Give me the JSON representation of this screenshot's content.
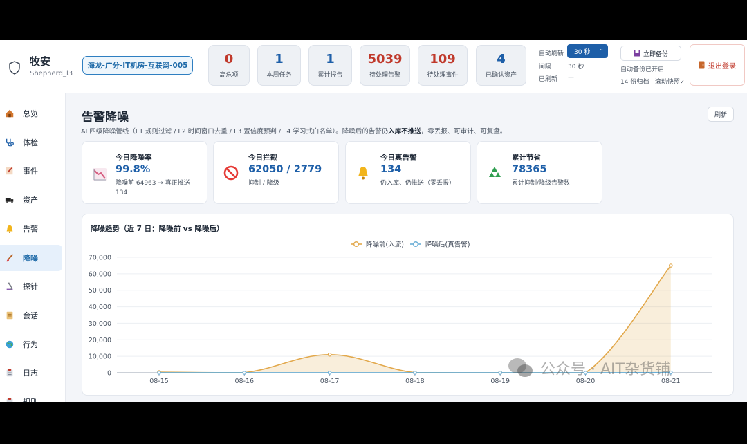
{
  "brand": {
    "name": "牧安",
    "user": "Shepherd_l3",
    "site": "海龙-广分-IT机房-互联网-005"
  },
  "kpis": [
    {
      "value": "0",
      "label": "高危项",
      "color": "#c0392b"
    },
    {
      "value": "1",
      "label": "本周任务",
      "color": "#1e5fa8"
    },
    {
      "value": "1",
      "label": "累计报告",
      "color": "#1e5fa8"
    },
    {
      "value": "5039",
      "label": "待处理告警",
      "color": "#c0392b"
    },
    {
      "value": "109",
      "label": "待处理事件",
      "color": "#c0392b"
    },
    {
      "value": "4",
      "label": "已确认资产",
      "color": "#1e5fa8"
    }
  ],
  "refresh": {
    "label": "自动刷新",
    "select": "30 秒",
    "interval_label": "间隔",
    "interval": "30 秒",
    "refreshed_label": "已刷新",
    "refreshed": "—"
  },
  "backup": {
    "button": "立即备份",
    "status": "自动备份已开启",
    "count": "14 份归档",
    "snapshot": "滚动快照✓"
  },
  "logout": "退出登录",
  "nav": [
    {
      "label": "总览",
      "icon": "home-icon"
    },
    {
      "label": "体检",
      "icon": "stethoscope-icon"
    },
    {
      "label": "事件",
      "icon": "note-icon"
    },
    {
      "label": "资产",
      "icon": "truck-icon"
    },
    {
      "label": "告警",
      "icon": "bell-icon"
    },
    {
      "label": "降噪",
      "icon": "brush-icon",
      "active": true
    },
    {
      "label": "探针",
      "icon": "microscope-icon"
    },
    {
      "label": "会话",
      "icon": "scroll-icon"
    },
    {
      "label": "行为",
      "icon": "globe-icon"
    },
    {
      "label": "日志",
      "icon": "clipboard-icon"
    },
    {
      "label": "规则",
      "icon": "rules-icon"
    }
  ],
  "page": {
    "title": "告警降噪",
    "refresh": "刷新",
    "desc_pre": "AI 四级降噪管线（L1 规则过滤 / L2 时间窗口去重 / L3 置信度预判 / L4 学习式白名单）。降噪后的告警仍",
    "desc_bold": "入库不推送",
    "desc_post": "，零丢报、可审计、可复盘。"
  },
  "cards": [
    {
      "title": "今日降噪率",
      "value": "99.8%",
      "sub1": "降噪前 64963 → 真正推送",
      "sub2": "134",
      "icon": "chart-down-icon"
    },
    {
      "title": "今日拦截",
      "value": "62050 / 2779",
      "sub1": "抑制 / 降级",
      "sub2": "",
      "icon": "prohibited-icon"
    },
    {
      "title": "今日真告警",
      "value": "134",
      "sub1": "仍入库、仍推送（零丢报）",
      "sub2": "",
      "icon": "bell-icon"
    },
    {
      "title": "累计节省",
      "value": "78365",
      "sub1": "累计抑制/降级告警数",
      "sub2": "",
      "icon": "recycle-icon"
    }
  ],
  "chart_data": {
    "type": "line",
    "title": "降噪趋势（近 7 日：降噪前 vs 降噪后）",
    "categories": [
      "08-15",
      "08-16",
      "08-17",
      "08-18",
      "08-19",
      "08-20",
      "08-21"
    ],
    "series": [
      {
        "name": "降噪前(入流)",
        "color": "#e2a84b",
        "values": [
          400,
          100,
          11000,
          100,
          50,
          100,
          64963
        ],
        "area": true
      },
      {
        "name": "降噪后(真告警)",
        "color": "#6aaed6",
        "values": [
          20,
          10,
          20,
          10,
          10,
          10,
          134
        ]
      }
    ],
    "ylim": [
      0,
      70000
    ],
    "yticks": [
      "0",
      "10,000",
      "20,000",
      "30,000",
      "40,000",
      "50,000",
      "60,000",
      "70,000"
    ],
    "legend": "top-center",
    "grid": true,
    "smooth": true
  },
  "watermark": "公众号 · AIT杂货铺"
}
